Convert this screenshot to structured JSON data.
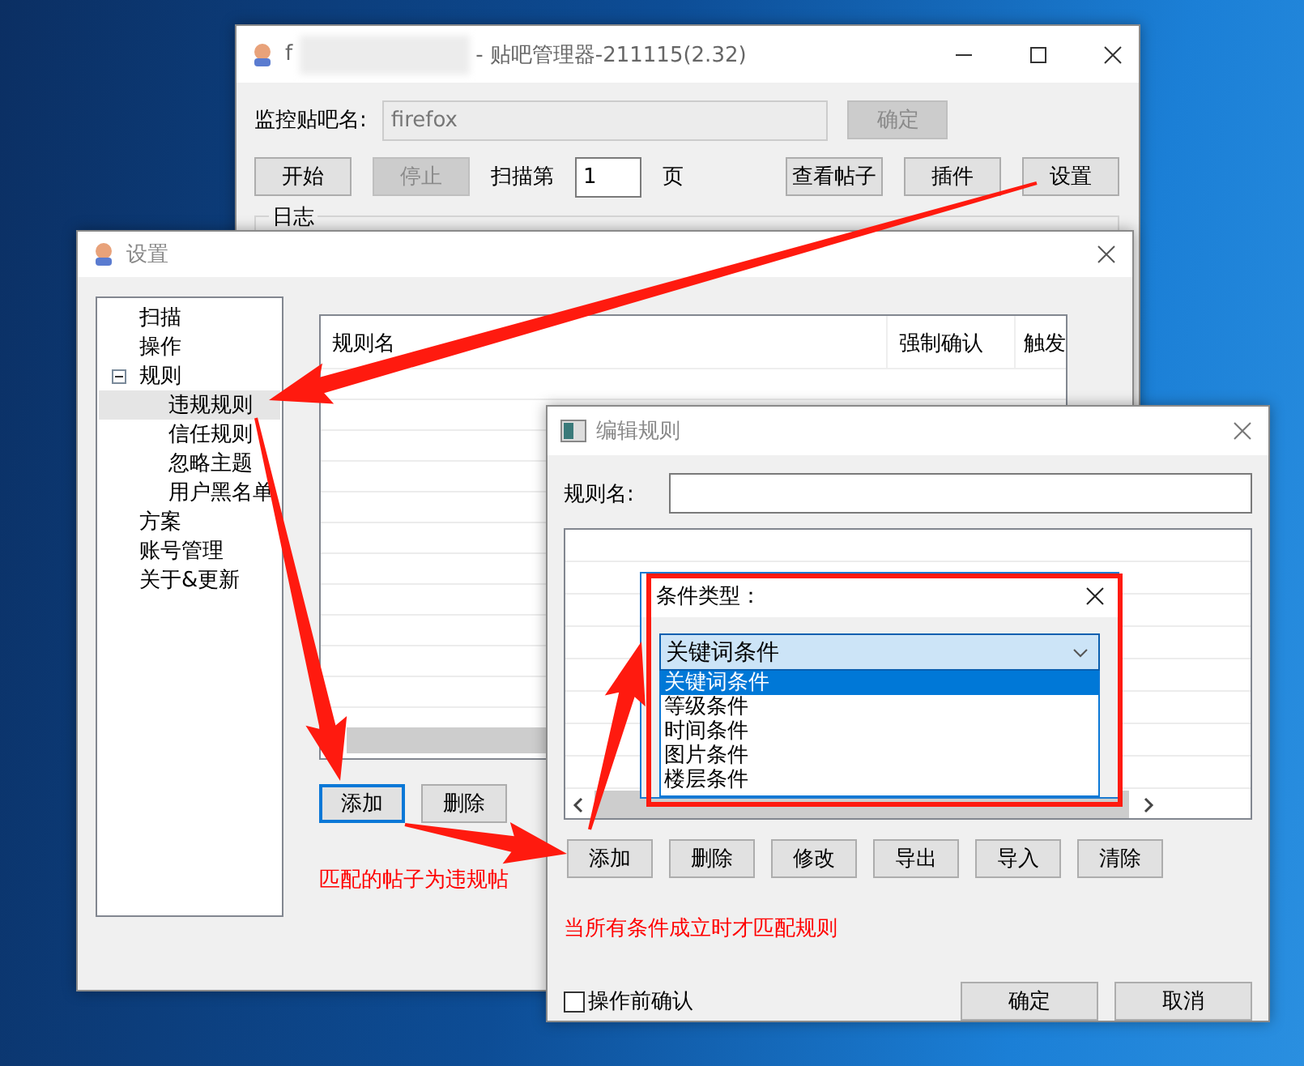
{
  "main_window": {
    "title_prefix": "f",
    "title": "- 贴吧管理器-211115(2.32)",
    "forum_label": "监控贴吧名:",
    "forum_value": "firefox",
    "confirm_button": {
      "label": "确定",
      "disabled": true
    },
    "buttons": [
      {
        "label": "开始",
        "disabled": false
      },
      {
        "label": "停止",
        "disabled": true
      }
    ],
    "scan_label": "扫描第",
    "page_value": "1",
    "page_suffix": "页",
    "right_buttons": [
      "查看帖子",
      "插件",
      "设置"
    ],
    "log_group": "日志"
  },
  "settings_window": {
    "title": "设置",
    "tree": [
      {
        "label": "扫描",
        "selected": false
      },
      {
        "label": "操作",
        "selected": false
      },
      {
        "label": "规则",
        "selected": false,
        "expanded": true,
        "children": [
          {
            "label": "违规规则",
            "selected": true
          },
          {
            "label": "信任规则",
            "selected": false
          },
          {
            "label": "忽略主题",
            "selected": false
          },
          {
            "label": "用户黑名单",
            "selected": false
          }
        ]
      },
      {
        "label": "方案",
        "selected": false
      },
      {
        "label": "账号管理",
        "selected": false
      },
      {
        "label": "关于&更新",
        "selected": false
      }
    ],
    "table": {
      "columns": [
        "规则名",
        "强制确认",
        "触发"
      ]
    },
    "buttons": [
      {
        "label": "添加",
        "selected": true
      },
      {
        "label": "删除",
        "selected": false
      }
    ],
    "hint": "匹配的帖子为违规帖"
  },
  "edit_window": {
    "title": "编辑规则",
    "name_label": "规则名:",
    "buttons": [
      "添加",
      "删除",
      "修改",
      "导出",
      "导入",
      "清除"
    ],
    "hint": "当所有条件成立时才匹配规则",
    "confirm_checkbox": {
      "label": "操作前确认",
      "checked": false
    },
    "ok_button": "确定",
    "cancel_button": "取消"
  },
  "condition_popup": {
    "title": "条件类型：",
    "value": "关键词条件",
    "options": [
      {
        "label": "关键词条件",
        "selected": true
      },
      {
        "label": "等级条件",
        "selected": false
      },
      {
        "label": "时间条件",
        "selected": false
      },
      {
        "label": "图片条件",
        "selected": false
      },
      {
        "label": "楼层条件",
        "selected": false
      }
    ]
  }
}
